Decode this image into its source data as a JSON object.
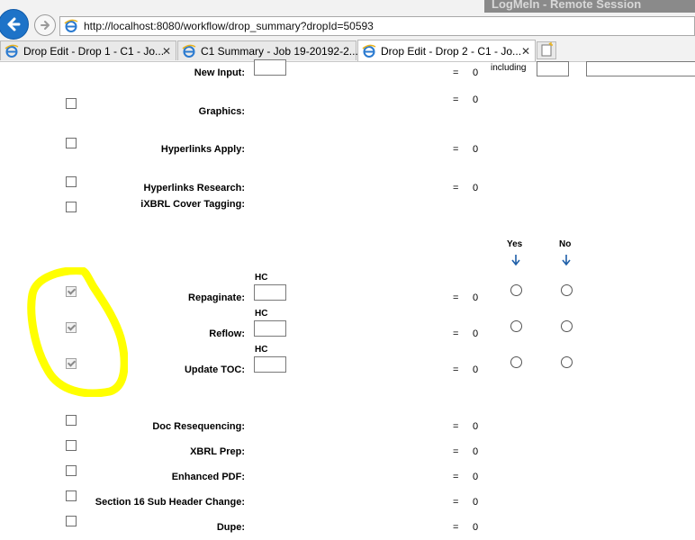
{
  "browser": {
    "overlay_title": "LogMeIn - Remote Session",
    "address": "http://localhost:8080/workflow/drop_summary?dropId=50593",
    "tabs": [
      {
        "label": "Drop Edit - Drop 1 - C1 - Jo...",
        "active": false
      },
      {
        "label": "C1 Summary - Job 19-20192-2...",
        "active": false
      },
      {
        "label": "Drop Edit - Drop 2 - C1 - Jo...",
        "active": true
      }
    ]
  },
  "page": {
    "eq_sign": "=",
    "including_label": "including",
    "hc_label": "HC",
    "yes_label": "Yes",
    "no_label": "No",
    "rows": [
      {
        "key": "new_input",
        "label": "New Input:",
        "value": "0"
      },
      {
        "key": "graphics",
        "label": "Graphics:",
        "value": "0",
        "checked": false
      },
      {
        "key": "hyperlinks_apply",
        "label": "Hyperlinks Apply:",
        "value": "0",
        "checked": false
      },
      {
        "key": "hyperlinks_research",
        "label": "Hyperlinks Research:",
        "value": "0",
        "checked": false
      },
      {
        "key": "ixbrl_cover_tagging",
        "label": "iXBRL Cover Tagging:",
        "checked": false
      },
      {
        "key": "repaginate",
        "label": "Repaginate:",
        "value": "0",
        "checked": true
      },
      {
        "key": "reflow",
        "label": "Reflow:",
        "value": "0",
        "checked": true
      },
      {
        "key": "update_toc",
        "label": "Update TOC:",
        "value": "0",
        "checked": true
      },
      {
        "key": "doc_resequencing",
        "label": "Doc Resequencing:",
        "value": "0",
        "checked": false
      },
      {
        "key": "xbrl_prep",
        "label": "XBRL Prep:",
        "value": "0",
        "checked": false
      },
      {
        "key": "enhanced_pdf",
        "label": "Enhanced PDF:",
        "value": "0",
        "checked": false
      },
      {
        "key": "section16",
        "label": "Section 16 Sub Header Change:",
        "value": "0",
        "checked": false
      },
      {
        "key": "dupe",
        "label": "Dupe:",
        "value": "0",
        "checked": false
      }
    ]
  },
  "colors": {
    "highlight": "#ffff00",
    "back_button": "#1e73c8",
    "arrow": "#1f5fa8"
  }
}
